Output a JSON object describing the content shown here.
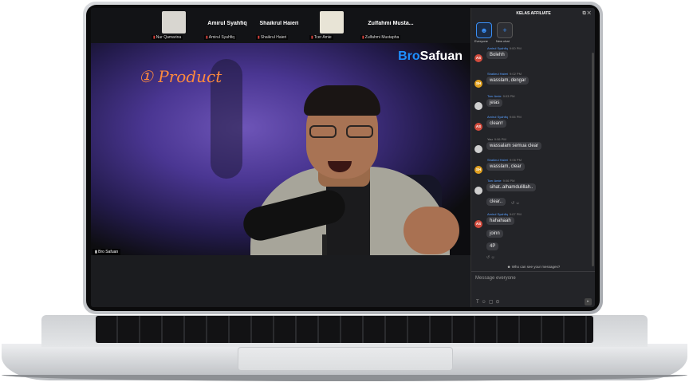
{
  "gallery": {
    "tiles": [
      {
        "name": "",
        "label": "Nur Qamarina"
      },
      {
        "name": "Amirul Syahfiq",
        "label": "Amirul Syahfiq"
      },
      {
        "name": "Shaikrul Haieri",
        "label": "Shaikrul Haieri"
      },
      {
        "name": "",
        "label": "Tcer Amie"
      },
      {
        "name": "Zulfahmi Musta...",
        "label": "Zulfahmi Mustapha"
      }
    ]
  },
  "video": {
    "overlay_text": "① Product",
    "brand_a": "Bro",
    "brand_b": "Safuan",
    "speaker_label": "Bro Safuan"
  },
  "chat": {
    "title": "KELAS AFFILIATE",
    "tab_everyone": "Everyone",
    "tab_new": "New chat",
    "who_can_see": "Who can see your messages?",
    "placeholder": "Message everyone",
    "messages": [
      {
        "sender": "Amirul Syahfiq",
        "time": "9:00 PM",
        "initials": "AS",
        "text": "Bolehh"
      },
      {
        "sender": "Shaikrul Haieri",
        "time": "9:02 PM",
        "initials": "SH",
        "text": "wasslam, dengar"
      },
      {
        "sender": "Tcer Amie",
        "time": "9:03 PM",
        "initials": "",
        "text": "jelas"
      },
      {
        "sender": "Amirul Syahfiq",
        "time": "9:06 PM",
        "initials": "AS",
        "text": "clearrr"
      },
      {
        "sender": "You",
        "time": "9:06 PM",
        "initials": "",
        "text": "wassalam semua clear"
      },
      {
        "sender": "Shaikrul Haieri",
        "time": "9:06 PM",
        "initials": "SH",
        "text": "wasslam, clear"
      },
      {
        "sender": "Tcer Amie",
        "time": "9:06 PM",
        "initials": "",
        "text": "sihat..alhamdulillah.."
      },
      {
        "sender": "",
        "time": "",
        "initials": "",
        "text": "clear.."
      },
      {
        "sender": "Amirul Syahfiq",
        "time": "9:07 PM",
        "initials": "AS",
        "text": "hahahaah"
      },
      {
        "sender": "",
        "time": "",
        "initials": "",
        "text": "joinn"
      },
      {
        "sender": "",
        "time": "",
        "initials": "",
        "text": "4P"
      }
    ]
  },
  "colors": {
    "accent": "#3a8ff5",
    "overlay": "#ff8a3d",
    "avatar_as": "#d14b3d",
    "avatar_sh": "#e0a020"
  }
}
